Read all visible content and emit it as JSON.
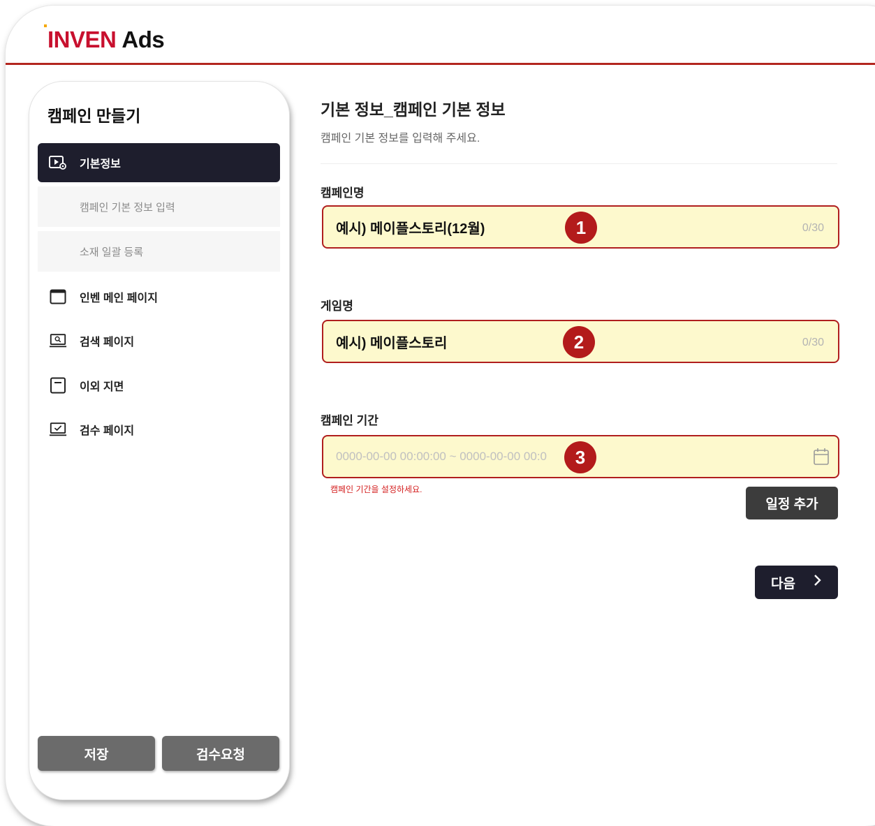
{
  "header": {
    "logo_brand": "INVEN",
    "logo_suffix": "Ads"
  },
  "sidebar": {
    "title": "캠페인 만들기",
    "active_item": {
      "label": "기본정보",
      "icon": "play-settings-icon"
    },
    "sub_items": [
      "캠페인 기본 정보 입력",
      "소재 일괄 등록"
    ],
    "items": [
      {
        "label": "인벤 메인 페이지",
        "icon": "window-icon"
      },
      {
        "label": "검색 페이지",
        "icon": "search-screen-icon"
      },
      {
        "label": "이외 지면",
        "icon": "page-icon"
      },
      {
        "label": "검수 페이지",
        "icon": "check-screen-icon"
      }
    ],
    "save_label": "저장",
    "review_label": "검수요청"
  },
  "main": {
    "title": "기본 정보_캠페인 기본 정보",
    "subtitle": "캠페인 기본 정보를 입력해 주세요.",
    "campaign_name": {
      "label": "캠페인명",
      "value": "예시) 메이플스토리(12월)",
      "counter": "0/30",
      "badge": "1"
    },
    "game_name": {
      "label": "게임명",
      "value": "예시) 메이플스토리",
      "counter": "0/30",
      "badge": "2"
    },
    "period": {
      "label": "캠페인 기간",
      "placeholder": "0000-00-00 00:00:00 ~ 0000-00-00 00:0",
      "badge": "3",
      "icon": "calendar-icon",
      "error": "캠페인 기간을 설정하세요."
    },
    "add_schedule_label": "일정 추가",
    "next_label": "다음"
  },
  "colors": {
    "accent_red": "#b31b1b",
    "dark_navy": "#1e1e2d",
    "field_bg": "#fdf9cd",
    "error": "#d42020"
  }
}
